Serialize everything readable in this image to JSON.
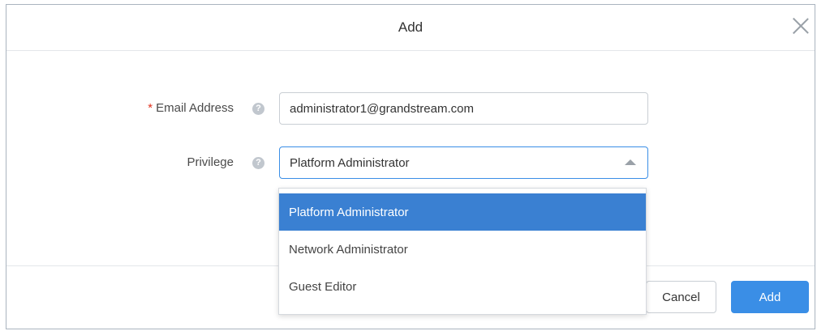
{
  "dialog": {
    "title": "Add",
    "close_icon": "close-icon"
  },
  "form": {
    "email": {
      "required_mark": "*",
      "label": "Email Address",
      "help_icon": "help-icon",
      "value": "administrator1@grandstream.com"
    },
    "privilege": {
      "label": "Privilege",
      "help_icon": "help-icon",
      "value": "Platform Administrator",
      "arrow_icon": "caret-up-icon",
      "options": [
        {
          "label": "Platform Administrator",
          "selected": true
        },
        {
          "label": "Network Administrator",
          "selected": false
        },
        {
          "label": "Guest Editor",
          "selected": false
        }
      ]
    }
  },
  "footer": {
    "cancel_label": "Cancel",
    "add_label": "Add"
  },
  "colors": {
    "accent": "#3a8ee6",
    "selected_option": "#3a80d2",
    "required": "#e0311d"
  }
}
